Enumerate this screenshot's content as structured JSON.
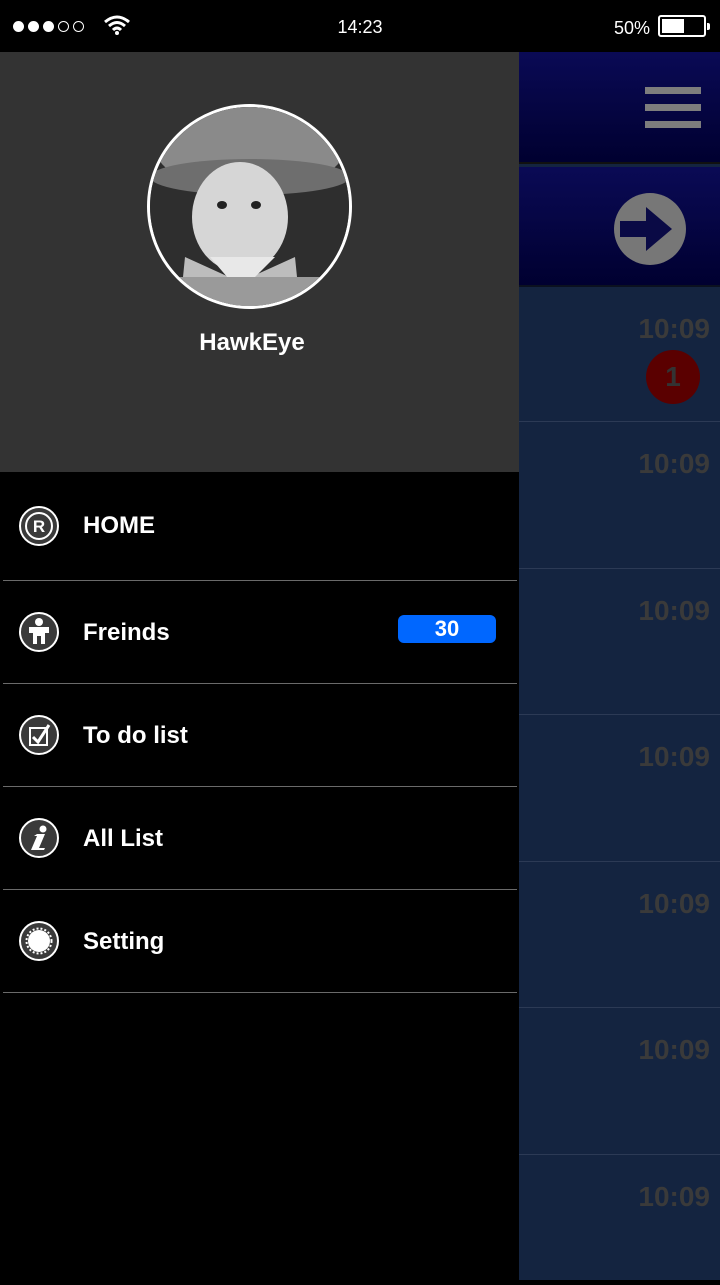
{
  "status_bar": {
    "signal_dots": [
      "full",
      "full",
      "full",
      "empty",
      "empty"
    ],
    "time": "14:23",
    "battery_percent": "50%",
    "battery_level": 0.5
  },
  "profile": {
    "username": "HawkEye"
  },
  "menu": {
    "items": [
      {
        "label": "HOME",
        "icon": "registered-icon"
      },
      {
        "label": "Freinds",
        "icon": "person-icon",
        "count": "30"
      },
      {
        "label": "To do list",
        "icon": "checkbox-icon"
      },
      {
        "label": "All List",
        "icon": "info-icon"
      },
      {
        "label": "Setting",
        "icon": "gear-icon"
      }
    ]
  },
  "background_list": {
    "times": [
      "10:09",
      "10:09",
      "10:09",
      "10:09",
      "10:09",
      "10:09",
      "10:09"
    ],
    "first_badge": "1"
  },
  "colors": {
    "count_badge": "#0067ff",
    "drawer_header": "#333333",
    "list_bg": "#142440"
  }
}
